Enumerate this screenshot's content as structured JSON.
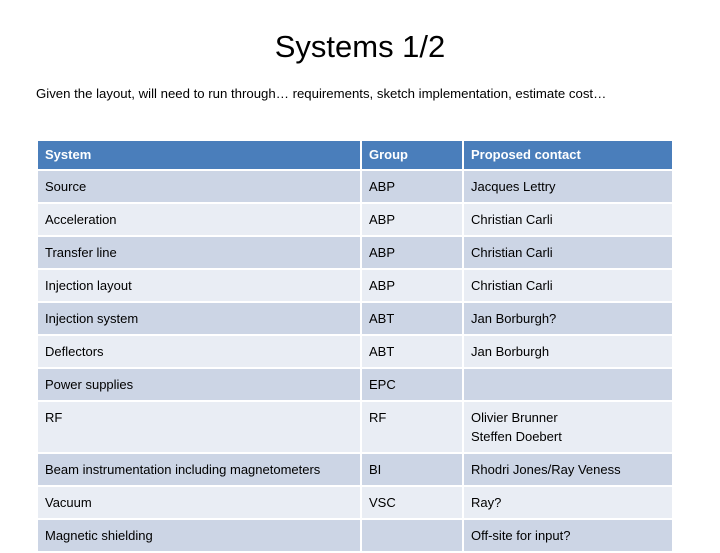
{
  "slide": {
    "title": "Systems 1/2",
    "intro": "Given the layout, will need to run through… requirements, sketch implementation, estimate cost…"
  },
  "table": {
    "headers": {
      "system": "System",
      "group": "Group",
      "contact": "Proposed contact"
    },
    "header_bg": "#4a7ebb",
    "row_dark_bg": "#ccd5e5",
    "row_light_bg": "#e9edf4",
    "link_color": "#1f3864",
    "rows": [
      {
        "system": "Source",
        "group": "ABP",
        "contact": "Jacques Lettry",
        "contact2": "",
        "highlight_contact": true
      },
      {
        "system": "Acceleration",
        "group": "ABP",
        "contact": "Christian Carli",
        "contact2": "",
        "highlight_contact": false
      },
      {
        "system": "Transfer line",
        "group": "ABP",
        "contact": "Christian Carli",
        "contact2": "",
        "highlight_contact": false
      },
      {
        "system": "Injection layout",
        "group": "ABP",
        "contact": "Christian Carli",
        "contact2": "",
        "highlight_contact": false
      },
      {
        "system": "Injection system",
        "group": "ABT",
        "contact": "Jan Borburgh?",
        "contact2": "",
        "highlight_contact": false
      },
      {
        "system": "Deflectors",
        "group": "ABT",
        "contact": "Jan Borburgh",
        "contact2": "",
        "highlight_contact": false
      },
      {
        "system": "Power supplies",
        "group": "EPC",
        "contact": "",
        "contact2": "",
        "highlight_contact": false
      },
      {
        "system": "RF",
        "group": "RF",
        "contact": "Olivier Brunner",
        "contact2": "Steffen Doebert",
        "highlight_contact": false
      },
      {
        "system": "Beam instrumentation including magnetometers",
        "group": "BI",
        "contact": "Rhodri Jones/Ray Veness",
        "contact2": "",
        "highlight_contact": false
      },
      {
        "system": "Vacuum",
        "group": "VSC",
        "contact": "Ray?",
        "contact2": "",
        "highlight_contact": false
      },
      {
        "system": "Magnetic shielding",
        "group": "",
        "contact": "Off-site for input?",
        "contact2": "",
        "highlight_contact": false
      }
    ]
  }
}
